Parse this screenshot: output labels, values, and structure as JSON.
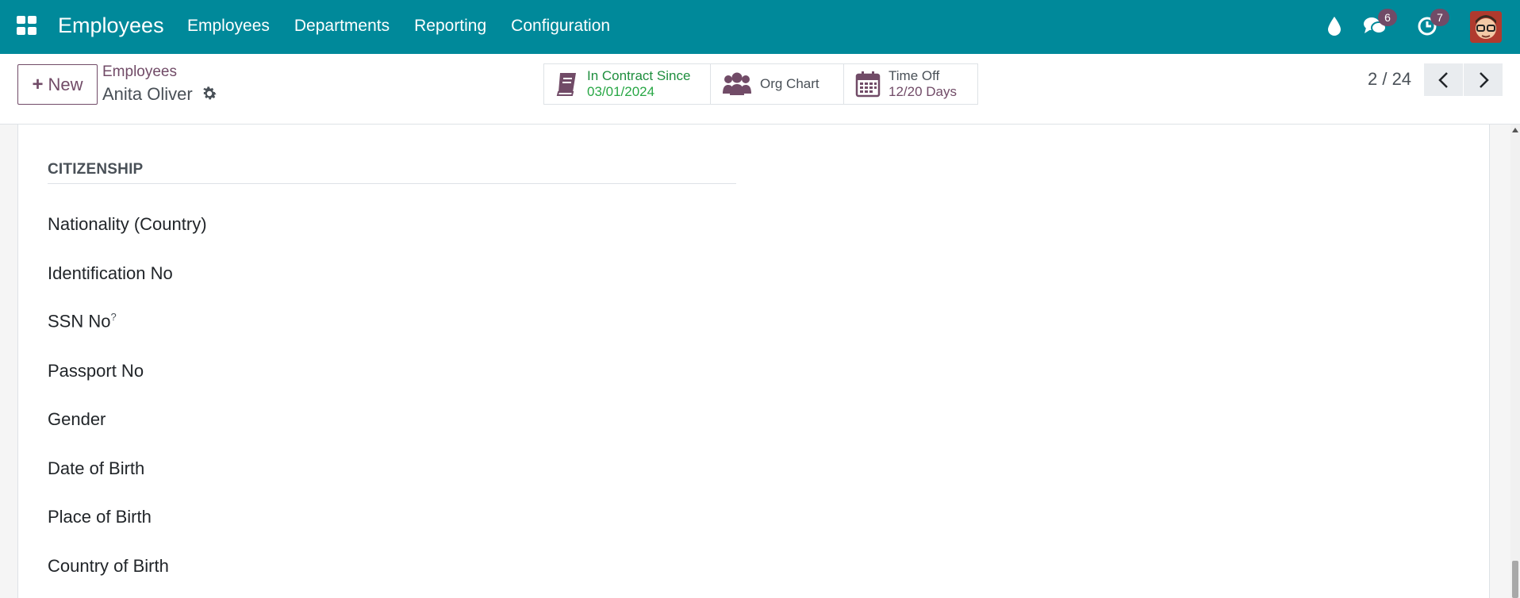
{
  "app": {
    "title": "Employees"
  },
  "menu": {
    "items": [
      {
        "label": "Employees"
      },
      {
        "label": "Departments"
      },
      {
        "label": "Reporting"
      },
      {
        "label": "Configuration"
      }
    ]
  },
  "systray": {
    "messages_count": "6",
    "activities_count": "7"
  },
  "control": {
    "new_label": "New",
    "breadcrumb_parent": "Employees",
    "breadcrumb_current": "Anita Oliver",
    "pager": "2 / 24"
  },
  "smart_buttons": {
    "contract": {
      "line1": "In Contract Since",
      "line2": "03/01/2024"
    },
    "orgchart": {
      "line1": "Org Chart"
    },
    "timeoff": {
      "line1": "Time Off",
      "line2": "12/20 Days"
    }
  },
  "form": {
    "section_title": "CITIZENSHIP",
    "fields": [
      {
        "label": "Nationality (Country)"
      },
      {
        "label": "Identification No"
      },
      {
        "label": "SSN No",
        "help": "?"
      },
      {
        "label": "Passport No"
      },
      {
        "label": "Gender"
      },
      {
        "label": "Date of Birth"
      },
      {
        "label": "Place of Birth"
      },
      {
        "label": "Country of Birth"
      }
    ]
  },
  "colors": {
    "navbar": "#00899a",
    "brand_purple": "#714b67",
    "success_green": "#1e8e3e"
  }
}
